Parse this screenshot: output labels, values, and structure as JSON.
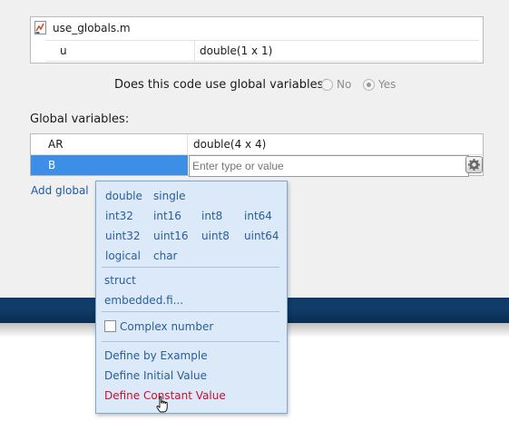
{
  "file_table": {
    "file_name": "use_globals.m",
    "input_var": {
      "name": "u",
      "type": "double(1 x 1)"
    }
  },
  "question": {
    "text": "Does this code use global variables?",
    "options": [
      {
        "label": "No",
        "checked": false
      },
      {
        "label": "Yes",
        "checked": true
      }
    ]
  },
  "globals": {
    "label": "Global variables:",
    "rows": [
      {
        "name": "AR",
        "type": "double(4 x 4)"
      },
      {
        "name": "B",
        "type_placeholder": "Enter type or value"
      }
    ],
    "add_label": "Add global"
  },
  "type_menu": {
    "numeric_grid": [
      [
        "double",
        "single"
      ],
      [
        "int32",
        "int16",
        "int8",
        "int64"
      ],
      [
        "uint32",
        "uint16",
        "uint8",
        "uint64"
      ],
      [
        "logical",
        "char"
      ]
    ],
    "other_types": [
      "struct",
      "embedded.fi..."
    ],
    "complex_label": "Complex number",
    "complex_checked": false,
    "define_options": [
      "Define by Example",
      "Define Initial Value",
      "Define Constant Value"
    ],
    "hovered": "Define Constant Value"
  },
  "colors": {
    "selection": "#3d8ee6",
    "menu_bg": "#dbe9f8",
    "link": "#1c5aa6",
    "hover_red": "#c8102e"
  }
}
